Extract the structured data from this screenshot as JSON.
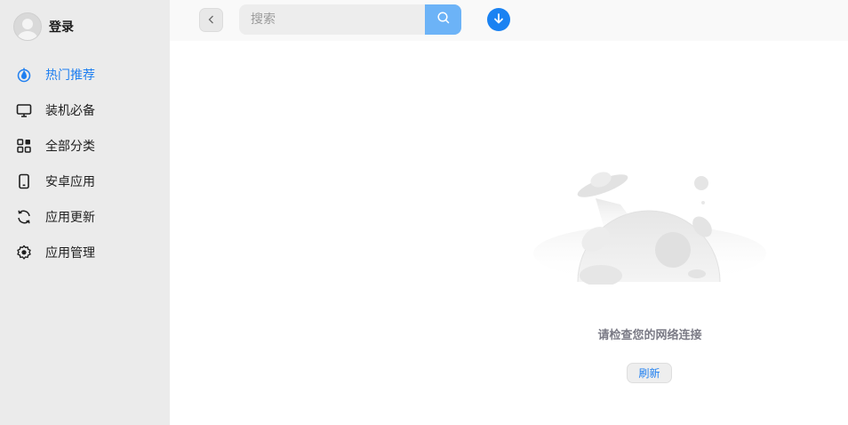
{
  "sidebar": {
    "user": {
      "login_label": "登录",
      "avatar_icon": "user-avatar-icon"
    },
    "items": [
      {
        "label": "热门推荐",
        "icon": "flame-icon",
        "active": true
      },
      {
        "label": "装机必备",
        "icon": "monitor-icon",
        "active": false
      },
      {
        "label": "全部分类",
        "icon": "grid-icon",
        "active": false
      },
      {
        "label": "安卓应用",
        "icon": "phone-icon",
        "active": false
      },
      {
        "label": "应用更新",
        "icon": "refresh-icon",
        "active": false
      },
      {
        "label": "应用管理",
        "icon": "gear-icon",
        "active": false
      }
    ]
  },
  "topbar": {
    "back_icon": "chevron-left-icon",
    "search": {
      "placeholder": "搜索",
      "value": "",
      "icon": "search-icon"
    },
    "download_icon": "download-icon"
  },
  "main": {
    "empty_state": {
      "illustration": "ufo-planet-illustration",
      "message": "请检查您的网络连接",
      "refresh_label": "刷新"
    }
  },
  "colors": {
    "accent": "#1f7ff0",
    "sidebar_bg": "#ebebeb",
    "search_button": "#6cb3f7",
    "download_button": "#1a82f2",
    "message_text": "#7b7b86"
  }
}
